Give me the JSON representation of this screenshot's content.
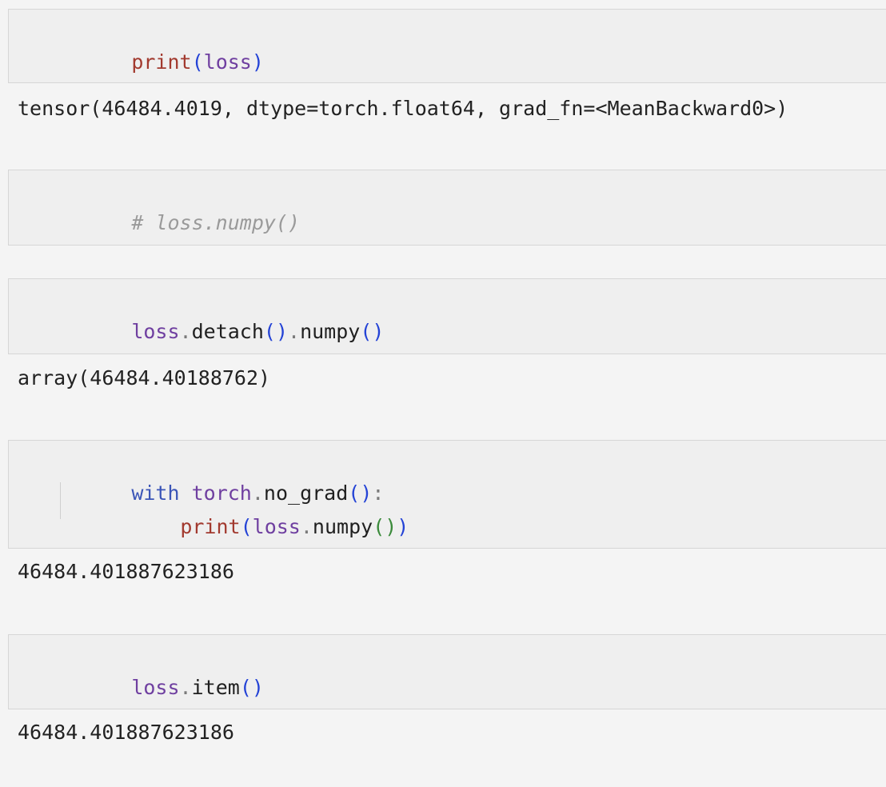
{
  "cells": [
    {
      "input": {
        "builtin": "print",
        "open": "(",
        "arg": "loss",
        "close": ")"
      },
      "output": "tensor(46484.4019, dtype=torch.float64, grad_fn=<MeanBackward0>)"
    },
    {
      "input": {
        "comment": "# loss.numpy()"
      },
      "output": ""
    },
    {
      "input": {
        "var": "loss",
        "dot1": ".",
        "method1": "detach",
        "paren1": "()",
        "dot2": ".",
        "method2": "numpy",
        "paren2": "()"
      },
      "output": "array(46484.40188762)"
    },
    {
      "input": {
        "line1": {
          "keyword": "with",
          "module": "torch",
          "dot": ".",
          "func": "no_grad",
          "paren": "()",
          "colon": ":"
        },
        "line2": {
          "builtin": "print",
          "open": "(",
          "var": "loss",
          "dot": ".",
          "method": "numpy",
          "inner": "()",
          "close": ")"
        }
      },
      "output": "46484.401887623186"
    },
    {
      "input": {
        "var": "loss",
        "dot": ".",
        "method": "item",
        "paren": "()"
      },
      "output": "46484.401887623186"
    }
  ]
}
